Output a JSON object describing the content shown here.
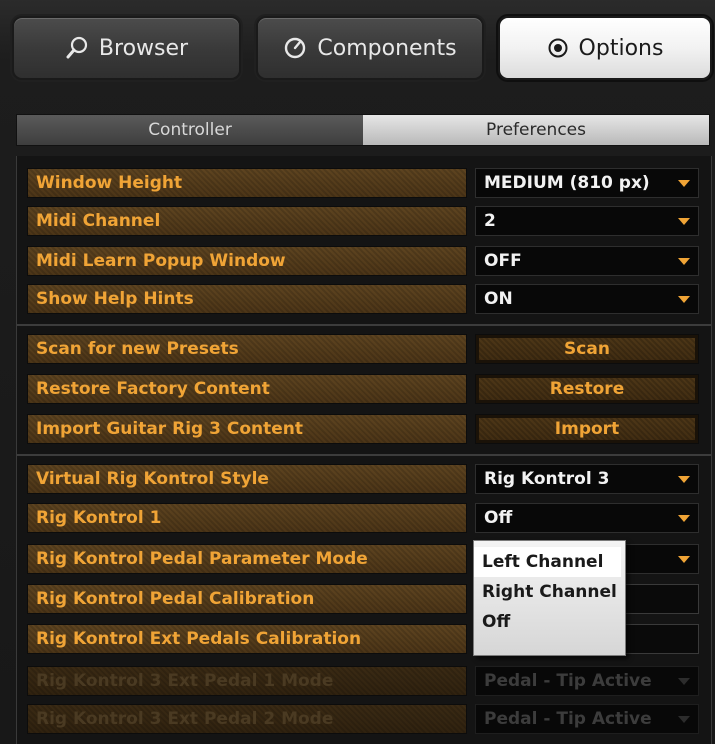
{
  "top_tabs": [
    {
      "label": "Browser",
      "icon": "magnifier-icon"
    },
    {
      "label": "Components",
      "icon": "gauge-icon"
    },
    {
      "label": "Options",
      "icon": "radio-circle-icon"
    }
  ],
  "sub_tabs": [
    {
      "label": "Controller"
    },
    {
      "label": "Preferences"
    }
  ],
  "active_top_tab": "Options",
  "active_sub_tab": "Controller",
  "settings": {
    "window_height": {
      "label": "Window Height",
      "value": "MEDIUM (810 px)"
    },
    "midi_channel": {
      "label": "Midi Channel",
      "value": "2"
    },
    "midi_learn_popup": {
      "label": "Midi Learn Popup Window",
      "value": "OFF"
    },
    "show_help_hints": {
      "label": "Show Help Hints",
      "value": "ON"
    },
    "scan_presets": {
      "label": "Scan for new Presets",
      "button": "Scan"
    },
    "restore_factory": {
      "label": "Restore Factory Content",
      "button": "Restore"
    },
    "import_gr3": {
      "label": "Import Guitar Rig 3 Content",
      "button": "Import"
    },
    "virtual_rk_style": {
      "label": "Virtual Rig Kontrol Style",
      "value": "Rig Kontrol 3"
    },
    "rig_kontrol_1": {
      "label": "Rig Kontrol 1",
      "value": "Off"
    },
    "rk_pedal_param_mode": {
      "label": "Rig Kontrol Pedal Parameter Mode",
      "value": ""
    },
    "rk_pedal_calibration": {
      "label": "Rig Kontrol Pedal Calibration"
    },
    "rk_ext_pedals_calibration": {
      "label": "Rig Kontrol Ext Pedals Calibration"
    },
    "rk3_ext_pedal_1_mode": {
      "label": "Rig Kontrol 3 Ext Pedal 1 Mode",
      "value": "Pedal - Tip Active",
      "disabled": true
    },
    "rk3_ext_pedal_2_mode": {
      "label": "Rig Kontrol 3 Ext Pedal 2 Mode",
      "value": "Pedal - Tip Active",
      "disabled": true
    }
  },
  "popup": {
    "options": [
      "Left Channel",
      "Right Channel",
      "Off"
    ],
    "highlighted": "Left Channel"
  },
  "colors": {
    "label_text": "#f0a436",
    "label_bg": "#5e4420",
    "panel_bg": "#141414",
    "active_tab_bg": "#ffffff"
  }
}
